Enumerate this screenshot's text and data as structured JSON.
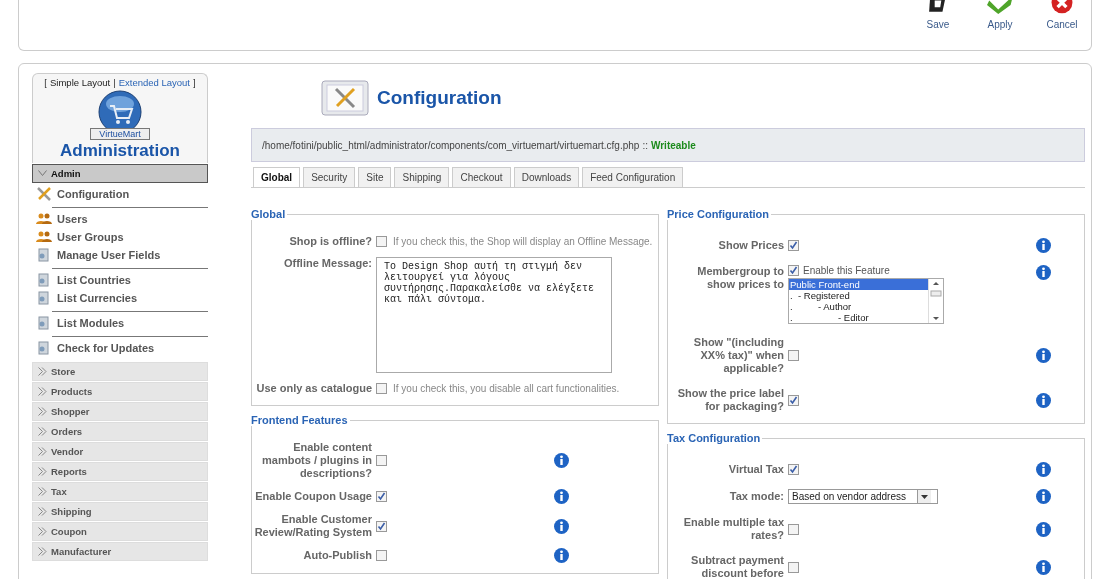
{
  "toolbar": {
    "buttons": [
      {
        "label": "Save",
        "kind": "save"
      },
      {
        "label": "Apply",
        "kind": "apply"
      },
      {
        "label": "Cancel",
        "kind": "cancel"
      }
    ]
  },
  "sidebar": {
    "layout_switch": {
      "open": "[",
      "separator": "|",
      "close": "]",
      "links": [
        {
          "label": "Simple Layout",
          "selected": true
        },
        {
          "label": "Extended Layout",
          "selected": false
        }
      ]
    },
    "logo_text": "VirtueMart",
    "title": "Administration",
    "sections": [
      {
        "label": "Admin",
        "expanded": true,
        "groups": [
          {
            "items": [
              {
                "label": "Configuration",
                "kind": "tools"
              }
            ]
          },
          {
            "items": [
              {
                "label": "Users",
                "kind": "users"
              },
              {
                "label": "User Groups",
                "kind": "users"
              },
              {
                "label": "Manage User Fields",
                "kind": "page"
              }
            ]
          },
          {
            "items": [
              {
                "label": "List Countries",
                "kind": "page"
              },
              {
                "label": "List Currencies",
                "kind": "page"
              }
            ]
          },
          {
            "items": [
              {
                "label": "List Modules",
                "kind": "page"
              }
            ]
          },
          {
            "items": [
              {
                "label": "Check for Updates",
                "kind": "page"
              }
            ]
          }
        ]
      },
      {
        "label": "Store",
        "expanded": false
      },
      {
        "label": "Products",
        "expanded": false
      },
      {
        "label": "Shopper",
        "expanded": false
      },
      {
        "label": "Orders",
        "expanded": false
      },
      {
        "label": "Vendor",
        "expanded": false
      },
      {
        "label": "Reports",
        "expanded": false
      },
      {
        "label": "Tax",
        "expanded": false
      },
      {
        "label": "Shipping",
        "expanded": false
      },
      {
        "label": "Coupon",
        "expanded": false
      },
      {
        "label": "Manufacturer",
        "expanded": false
      }
    ]
  },
  "main": {
    "title": "Configuration",
    "path": "/home/fotini/public_html/administrator/components/com_virtuemart/virtuemart.cfg.php",
    "path_separator": "::",
    "status": "Writeable",
    "tabs": [
      {
        "label": "Global",
        "selected": true
      },
      {
        "label": "Security",
        "selected": false
      },
      {
        "label": "Site",
        "selected": false
      },
      {
        "label": "Shipping",
        "selected": false
      },
      {
        "label": "Checkout",
        "selected": false
      },
      {
        "label": "Downloads",
        "selected": false
      },
      {
        "label": "Feed Configuration",
        "selected": false
      }
    ],
    "columns": [
      {
        "fieldsets": [
          {
            "legend": "Global",
            "rows": [
              {
                "kind": "checkbox",
                "label": "Shop is offline?",
                "checked": false,
                "description": "If you check this, the Shop will display an Offline Message."
              },
              {
                "kind": "textarea",
                "label": "Offline Message:",
                "value": "Το Design Shop αυτή τη στιγμή δεν λειτουργεί για λόγους συντήρησης.Παρακαλείσθε να ελέγξετε και πάλι σύντομα."
              },
              {
                "kind": "checkbox",
                "label": "Use only as catalogue",
                "checked": false,
                "description": "If you check this, you disable all cart functionalities."
              }
            ]
          },
          {
            "legend": "Frontend Features",
            "rows": [
              {
                "kind": "checkbox",
                "label": "Enable content mambots / plugins in descriptions?",
                "checked": false,
                "info": true
              },
              {
                "kind": "checkbox",
                "label": "Enable Coupon Usage",
                "checked": true,
                "info": true
              },
              {
                "kind": "checkbox",
                "label": "Enable Customer Review/Rating System",
                "checked": true,
                "info": true
              },
              {
                "kind": "checkbox",
                "label": "Auto-Publish",
                "checked": false,
                "info": true
              }
            ]
          }
        ]
      },
      {
        "fieldsets": [
          {
            "legend": "Price Configuration",
            "rows": [
              {
                "kind": "checkbox",
                "label": "Show Prices",
                "checked": true,
                "info": true
              },
              {
                "kind": "checklist",
                "label": "Membergroup to show prices to",
                "checked": true,
                "check_label": "Enable this Feature",
                "info": true,
                "options": [
                  {
                    "label": "Public Front-end",
                    "selected": true
                  },
                  {
                    "marker": ".",
                    "label": "- Registered",
                    "selected": false,
                    "children": [
                      {
                        "marker": ".",
                        "label": "- Author",
                        "selected": false,
                        "children": [
                          {
                            "marker": ".",
                            "label": "- Editor",
                            "selected": false
                          }
                        ]
                      }
                    ]
                  }
                ]
              },
              {
                "kind": "checkbox",
                "label": "Show \"(including XX% tax)\" when applicable?",
                "checked": false,
                "info": true
              },
              {
                "kind": "checkbox",
                "label": "Show the price label for packaging?",
                "checked": true,
                "info": true
              }
            ]
          },
          {
            "legend": "Tax Configuration",
            "rows": [
              {
                "kind": "checkbox",
                "label": "Virtual Tax",
                "checked": true,
                "info": true
              },
              {
                "kind": "select",
                "label": "Tax mode:",
                "value": "Based on vendor address",
                "info": true
              },
              {
                "kind": "checkbox",
                "label": "Enable multiple tax rates?",
                "checked": false,
                "info": true
              },
              {
                "kind": "checkbox",
                "label": "Subtract payment discount before",
                "checked": false,
                "info": true
              }
            ]
          }
        ]
      }
    ]
  }
}
